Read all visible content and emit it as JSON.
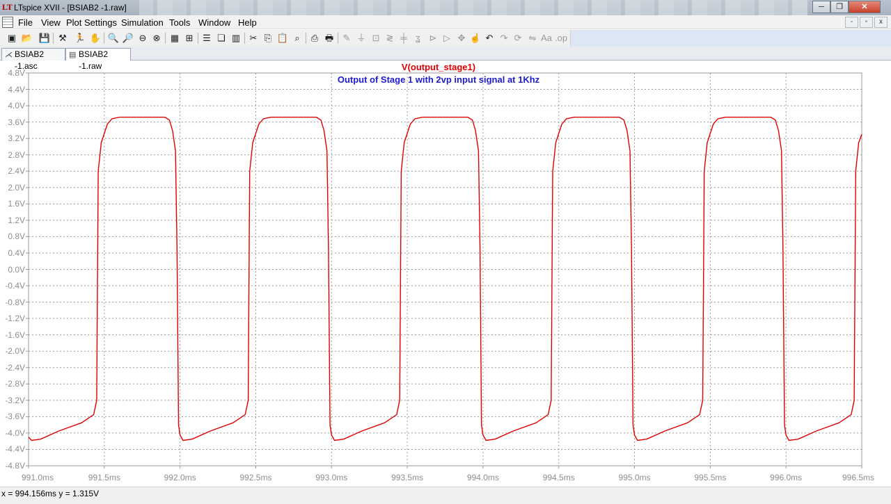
{
  "window": {
    "title": "LTspice XVII - [BSIAB2 -1.raw]",
    "min_glyph": "─",
    "max_glyph": "❐",
    "close_glyph": "✕"
  },
  "menu": {
    "items": [
      "File",
      "View",
      "Plot Settings",
      "Simulation",
      "Tools",
      "Window",
      "Help"
    ],
    "mdi_buttons": [
      "-",
      "▫",
      "x"
    ]
  },
  "toolbar": {
    "icons": [
      "new-schematic",
      "open",
      "save",
      "control-panel",
      "run",
      "halt",
      "zoom-in",
      "zoom-pan",
      "zoom-out",
      "zoom-fit",
      "autorange",
      "zoom-extents",
      "tile-horizontal",
      "cascade",
      "tile-vertical",
      "cut",
      "copy",
      "paste",
      "find",
      "print",
      "print-setup",
      "draw-wire",
      "ground",
      "label",
      "resistor",
      "capacitor",
      "inductor",
      "diode",
      "component",
      "move",
      "drag",
      "undo",
      "redo",
      "rotate",
      "mirror",
      "text",
      "spice-directive"
    ]
  },
  "tabs": [
    {
      "label": "BSIAB2 -1.asc",
      "active": false
    },
    {
      "label": "BSIAB2 -1.raw",
      "active": true
    }
  ],
  "plot": {
    "trace_name": "V(output_stage1)",
    "annotation": "Output of Stage 1 with 2vp input signal at 1Khz",
    "background": "#ffffff",
    "grid_color": "#9a9a9a",
    "trace_color": "#e00000",
    "annotation_color": "#1c1ccc",
    "y_tick_labels": [
      "4.8V",
      "4.4V",
      "4.0V",
      "3.6V",
      "3.2V",
      "2.8V",
      "2.4V",
      "2.0V",
      "1.6V",
      "1.2V",
      "0.8V",
      "0.4V",
      "0.0V",
      "-0.4V",
      "-0.8V",
      "-1.2V",
      "-1.6V",
      "-2.0V",
      "-2.4V",
      "-2.8V",
      "-3.2V",
      "-3.6V",
      "-4.0V",
      "-4.4V",
      "-4.8V"
    ],
    "x_tick_labels": [
      "991.0ms",
      "991.5ms",
      "992.0ms",
      "992.5ms",
      "993.0ms",
      "993.5ms",
      "994.0ms",
      "994.5ms",
      "995.0ms",
      "995.5ms",
      "996.0ms",
      "996.5ms"
    ]
  },
  "chart_data": {
    "type": "line",
    "x_unit": "ms",
    "y_unit": "V",
    "xlim": [
      991.0,
      996.5
    ],
    "ylim": [
      -4.8,
      4.8
    ],
    "grid": true,
    "series": [
      {
        "name": "V(output_stage1)",
        "color": "#e00000",
        "x": [
          991.0,
          991.02,
          991.08,
          991.2,
          991.35,
          991.43,
          991.45,
          991.46,
          991.48,
          991.52,
          991.55,
          991.6,
          991.9,
          991.93,
          991.95,
          991.97,
          991.98,
          991.99,
          992.0,
          992.02,
          992.08,
          992.2,
          992.35,
          992.43,
          992.45,
          992.46,
          992.48,
          992.52,
          992.55,
          992.6,
          992.9,
          992.93,
          992.95,
          992.97,
          992.98,
          992.99,
          993.0,
          993.02,
          993.08,
          993.2,
          993.35,
          993.43,
          993.45,
          993.46,
          993.48,
          993.52,
          993.55,
          993.6,
          993.9,
          993.93,
          993.95,
          993.97,
          993.98,
          993.99,
          994.0,
          994.02,
          994.08,
          994.2,
          994.35,
          994.43,
          994.45,
          994.46,
          994.48,
          994.52,
          994.55,
          994.6,
          994.9,
          994.93,
          994.95,
          994.97,
          994.98,
          994.99,
          995.0,
          995.02,
          995.08,
          995.2,
          995.35,
          995.43,
          995.45,
          995.46,
          995.48,
          995.52,
          995.55,
          995.6,
          995.9,
          995.93,
          995.95,
          995.97,
          995.98,
          995.99,
          996.0,
          996.02,
          996.08,
          996.2,
          996.35,
          996.43,
          996.45,
          996.46,
          996.48,
          996.5
        ],
        "y": [
          -4.1,
          -4.18,
          -4.15,
          -3.95,
          -3.75,
          -3.55,
          -3.2,
          2.4,
          3.1,
          3.55,
          3.68,
          3.72,
          3.72,
          3.65,
          3.4,
          2.9,
          0.5,
          -3.8,
          -4.05,
          -4.18,
          -4.15,
          -3.95,
          -3.75,
          -3.55,
          -3.2,
          2.4,
          3.1,
          3.55,
          3.68,
          3.72,
          3.72,
          3.65,
          3.4,
          2.9,
          0.5,
          -3.8,
          -4.05,
          -4.18,
          -4.15,
          -3.95,
          -3.75,
          -3.55,
          -3.2,
          2.4,
          3.1,
          3.55,
          3.68,
          3.72,
          3.72,
          3.65,
          3.4,
          2.9,
          0.5,
          -3.8,
          -4.05,
          -4.18,
          -4.15,
          -3.95,
          -3.75,
          -3.55,
          -3.2,
          2.4,
          3.1,
          3.55,
          3.68,
          3.72,
          3.72,
          3.65,
          3.4,
          2.9,
          0.5,
          -3.8,
          -4.05,
          -4.18,
          -4.15,
          -3.95,
          -3.75,
          -3.55,
          -3.2,
          2.4,
          3.1,
          3.55,
          3.68,
          3.72,
          3.72,
          3.65,
          3.4,
          2.9,
          0.5,
          -3.8,
          -4.05,
          -4.18,
          -4.15,
          -3.95,
          -3.75,
          -3.55,
          -3.2,
          2.4,
          3.1,
          3.3
        ]
      }
    ]
  },
  "status": {
    "text": "x = 994.156ms    y = 1.315V"
  }
}
